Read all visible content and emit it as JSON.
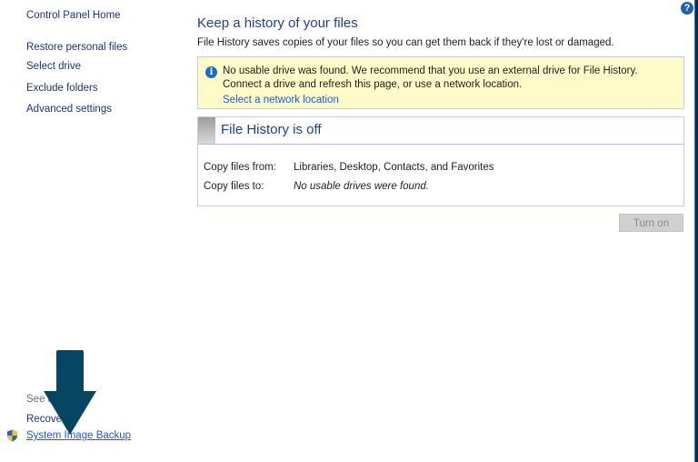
{
  "sidebar": {
    "home": "Control Panel Home",
    "items": [
      {
        "label": "Restore personal files"
      },
      {
        "label": "Select drive"
      },
      {
        "label": "Exclude folders"
      },
      {
        "label": "Advanced settings"
      }
    ],
    "see_also": "See also",
    "recovery": "Recovery",
    "system_image_backup": "System Image Backup"
  },
  "main": {
    "title": "Keep a history of your files",
    "description": "File History saves copies of your files so you can get them back if they're lost or damaged.",
    "warning": {
      "line1": "No usable drive was found. We recommend that you use an external drive for File History.",
      "line2": "Connect a drive and refresh this page, or use a network location.",
      "link": "Select a network location"
    },
    "status": {
      "title": "File History is off",
      "rows": [
        {
          "label": "Copy files from:",
          "value": "Libraries, Desktop, Contacts, and Favorites"
        },
        {
          "label": "Copy files to:",
          "value": "No usable drives were found."
        }
      ]
    },
    "turn_on_label": "Turn on"
  },
  "help": {
    "glyph": "?"
  },
  "info_glyph": "i",
  "colors": {
    "arrow": "#064663",
    "link": "#1e5bd0",
    "heading": "#1e3f9a",
    "warning_bg": "#fefbc8"
  }
}
